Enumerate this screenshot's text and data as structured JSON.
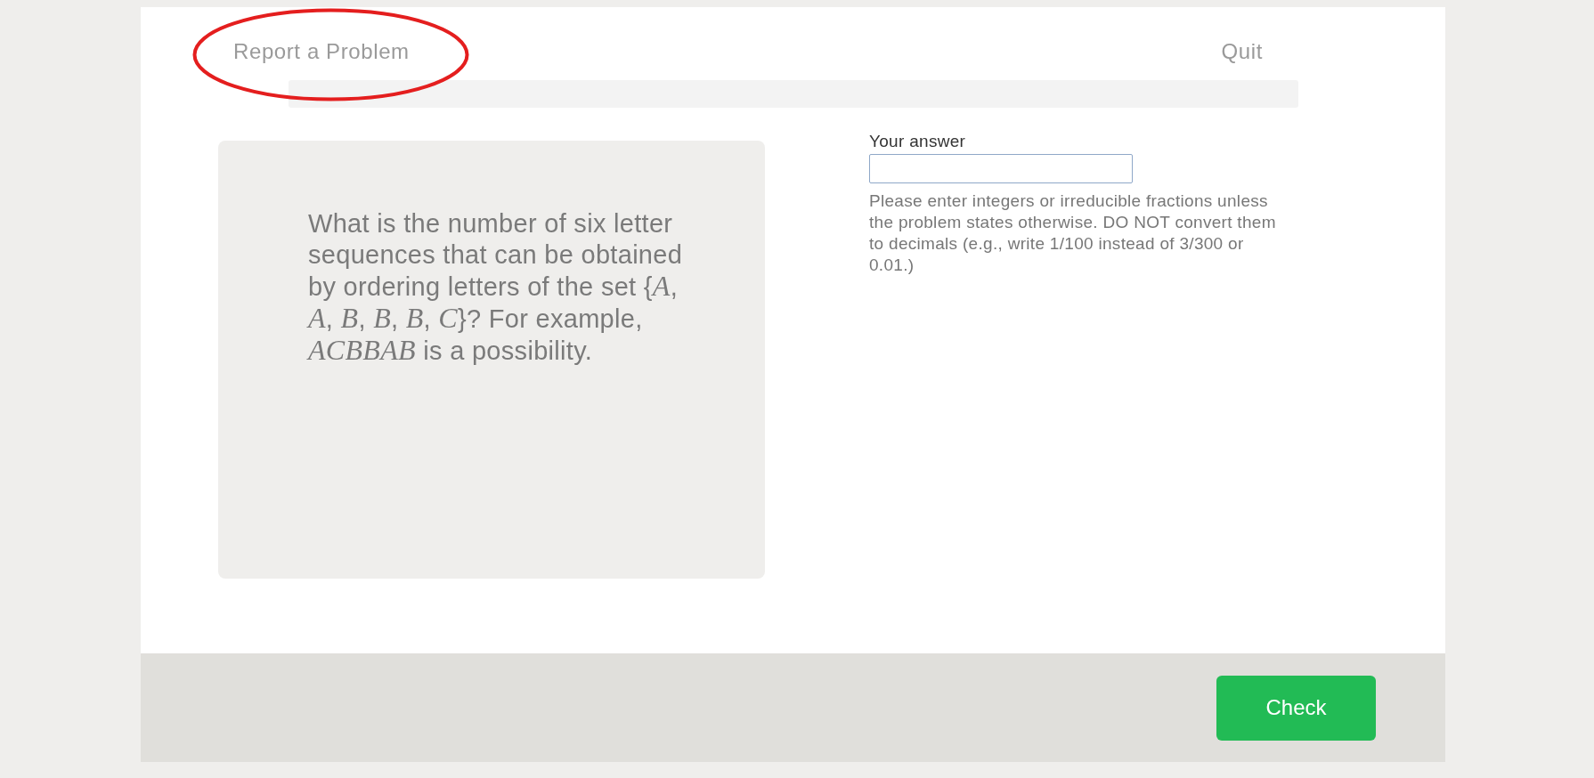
{
  "header": {
    "report_link": "Report a Problem",
    "quit_link": "Quit",
    "annotation": {
      "kind": "ellipse",
      "color": "#e41e1e"
    }
  },
  "progress": {
    "level": 0
  },
  "question": {
    "text": "What is the number of six letter sequences that can be obtained by ordering letters of the set {*A*, *A*, *B*, *B*, *B*, *C*}? For example, *ACBBAB* is a possibility."
  },
  "answer": {
    "label": "Your answer",
    "hint": "Please enter integers or irreducible fractions unless the problem states otherwise. DO NOT convert them to decimals (e.g., write 1/100 instead of 3/300 or 0.01.)"
  },
  "footer": {
    "button": "Check"
  }
}
